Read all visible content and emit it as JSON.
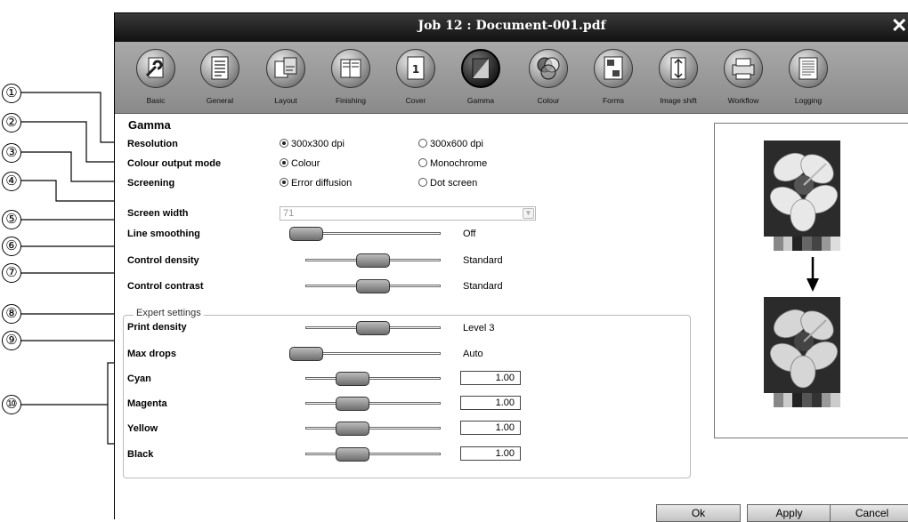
{
  "window": {
    "title": "Job 12 : Document-001.pdf",
    "close_glyph": "✕"
  },
  "toolbar": {
    "items": [
      {
        "label": "Basic",
        "icon": "wrench-document-icon"
      },
      {
        "label": "General",
        "icon": "document-icon"
      },
      {
        "label": "Layout",
        "icon": "layout-pages-icon"
      },
      {
        "label": "Finishing",
        "icon": "stapled-pages-icon"
      },
      {
        "label": "Cover",
        "icon": "cover-page-icon"
      },
      {
        "label": "Gamma",
        "icon": "gamma-gradient-icon",
        "active": true
      },
      {
        "label": "Colour",
        "icon": "colour-circles-icon"
      },
      {
        "label": "Forms",
        "icon": "forms-icon"
      },
      {
        "label": "Image shift",
        "icon": "image-shift-icon"
      },
      {
        "label": "Workflow",
        "icon": "workflow-printer-icon"
      },
      {
        "label": "Logging",
        "icon": "logging-icon"
      }
    ]
  },
  "form": {
    "section_title": "Gamma",
    "resolution": {
      "label": "Resolution",
      "opt1": "300x300 dpi",
      "opt2": "300x600 dpi",
      "selected": "300x300 dpi"
    },
    "colour_mode": {
      "label": "Colour output mode",
      "opt1": "Colour",
      "opt2": "Monochrome",
      "selected": "Colour"
    },
    "screening": {
      "label": "Screening",
      "opt1": "Error diffusion",
      "opt2": "Dot screen",
      "selected": "Error diffusion"
    },
    "screen_width": {
      "label": "Screen width",
      "value": "71"
    },
    "line_smoothing": {
      "label": "Line smoothing",
      "value": "Off",
      "level": 0.0
    },
    "control_density": {
      "label": "Control density",
      "value": "Standard",
      "level": 0.5
    },
    "control_contrast": {
      "label": "Control contrast",
      "value": "Standard",
      "level": 0.5
    },
    "expert": {
      "legend": "Expert settings",
      "print_density": {
        "label": "Print density",
        "value": "Level 3",
        "level": 0.5
      },
      "max_drops": {
        "label": "Max drops",
        "value": "Auto",
        "level": 0.0
      },
      "cyan": {
        "label": "Cyan",
        "value": "1.00",
        "level": 0.3
      },
      "magenta": {
        "label": "Magenta",
        "value": "1.00",
        "level": 0.3
      },
      "yellow": {
        "label": "Yellow",
        "value": "1.00",
        "level": 0.3
      },
      "black": {
        "label": "Black",
        "value": "1.00",
        "level": 0.3
      }
    }
  },
  "callouts": [
    "①",
    "②",
    "③",
    "④",
    "⑤",
    "⑥",
    "⑦",
    "⑧",
    "⑨",
    "⑩"
  ],
  "buttons": {
    "ok": "Ok",
    "apply": "Apply",
    "cancel": "Cancel"
  }
}
